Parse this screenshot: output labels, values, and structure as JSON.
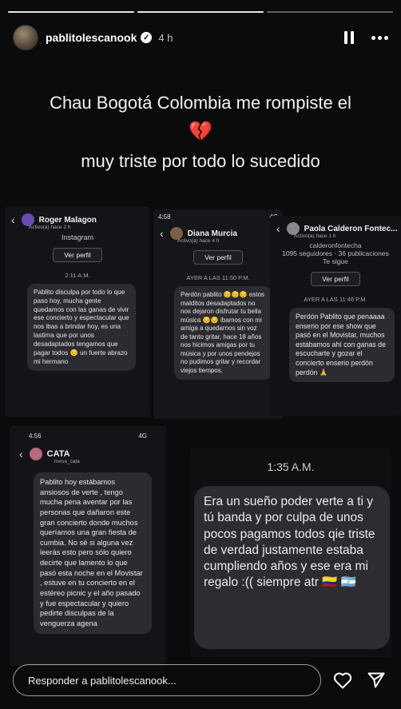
{
  "story": {
    "username": "pablitolescanook",
    "time": "4 h",
    "caption_line1": "Chau Bogotá Colombia me rompiste el",
    "caption_emoji": "💔",
    "caption_line2": "muy triste por todo lo sucedido",
    "progress_segments": 3,
    "progress_done": 2
  },
  "screenshots": [
    {
      "name": "Roger Malagon",
      "status": "Activo(a) hace 2 h",
      "platform": "Instagram",
      "button": "Ver perfil",
      "timestamp": "2:11 A.M.",
      "message": "Pablito disculpa por todo lo que paso hoy, mucha gente quedamos con las ganas de vivir ese concierto y espectacular que nos ibas a brindar hoy, es una lastima que por unos desadaptados tengamos que pagar todos 😔 un fuerte abrazo mi hermano"
    },
    {
      "clock": "4:58",
      "signal": "4G",
      "name": "Diana Murcia",
      "status": "Activo(a) hace 4 h",
      "button": "Ver perfil",
      "timestamp": "AYER A LAS 11:50 P.M.",
      "message": "Perdón pablito 😔😔😔 estos malditos desadaptados no nos dejaron disfrutar tu bella música 😔😔 íbamos con mi amiga a quedarnos sin voz de tanto gritar, hace 18 años nos hicimos amigas por tu música y por unos pendejos no pudimos gritar y recordar viejos tiempos."
    },
    {
      "name": "Paola Calderon Fontec...",
      "status": "Activo(a) hace 1 h",
      "handle": "calderonfontecha",
      "followers": "1095 seguidores · 36 publicaciones",
      "follow_note": "Te sigue",
      "button": "Ver perfil",
      "timestamp": "AYER A LAS 11:46 P.M.",
      "message": "Perdón Pablito que penaaaa enserio por ese show que pasó en el Movistar, muchos estábamos ahí con ganas de escucharte y gozar el concierto enserio perdón perdón 🙏"
    },
    {
      "clock": "4:56",
      "signal": "4G",
      "name": "CATA",
      "status": "mesa_cata",
      "message": "Pablito hoy estábamos ansiosos de verte , tengo mucha pena aventar por las personas que dañaron este gran concierto donde muchos queríamos una gran fiesta de cumbia. No sé si alguna vez leerás esto pero sólo quiero decirte que lamento lo que pasó esta noche en el Movistar , estuve en tu concierto en el estéreo picnic y el año pasado y fue espectacular y quiero pedirte disculpas de la venguerza agena"
    },
    {
      "timestamp": "1:35 A.M.",
      "message": "Era un sueño poder verte a ti y tú banda y por culpa de unos pocos pagamos todos qie triste de verdad justamente estaba cumpliendo años y ese era mi regalo :(( siempre atr 🇨🇴 🇦🇷"
    }
  ],
  "footer": {
    "reply_placeholder": "Responder a pablitolescanook..."
  },
  "icons": [
    "heart-outline-icon",
    "send-icon",
    "pause-icon",
    "more-icon",
    "verified-icon"
  ]
}
